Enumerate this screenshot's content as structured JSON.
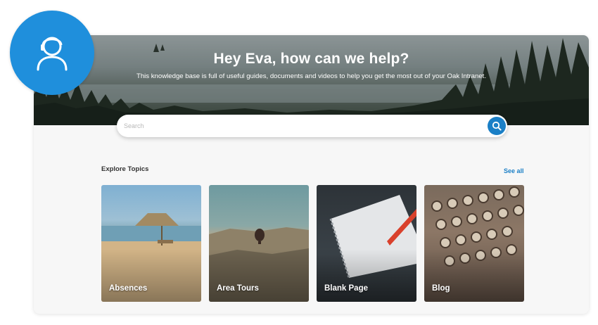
{
  "hero": {
    "title": "Hey Eva, how can we help?",
    "subtitle": "This knowledge base is full of useful guides, documents and videos to help you get the most out of your Oak Intranet."
  },
  "search": {
    "placeholder": "Search",
    "button_icon": "search-icon"
  },
  "topics": {
    "heading": "Explore Topics",
    "see_all_label": "See all",
    "items": [
      {
        "label": "Absences",
        "image": "beach-scene"
      },
      {
        "label": "Area Tours",
        "image": "hot-air-balloon-scene"
      },
      {
        "label": "Blank Page",
        "image": "notebook-pen-scene"
      },
      {
        "label": "Blog",
        "image": "typewriter-keys-scene"
      }
    ]
  },
  "avatar": {
    "icon": "user-headset-icon"
  },
  "colors": {
    "accent": "#1a7fc6",
    "avatar_bg": "#1f8fdc",
    "card_bg": "#f7f7f7"
  }
}
